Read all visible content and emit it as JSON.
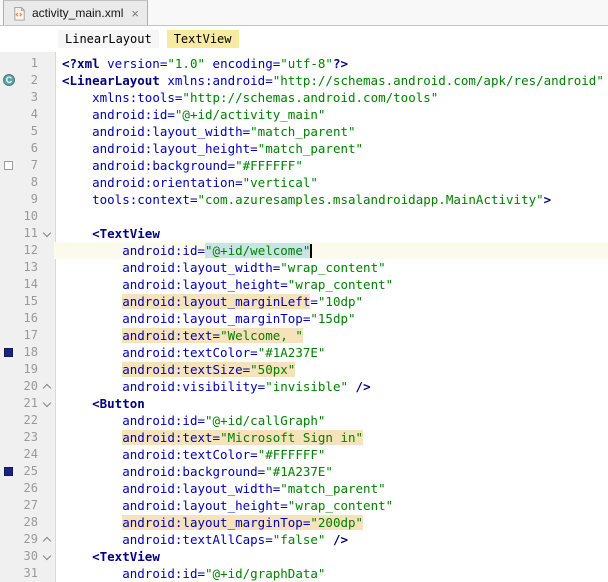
{
  "tab_bar": {
    "tabs": [
      {
        "label": "activity_main.xml",
        "close_glyph": "×"
      }
    ]
  },
  "breadcrumbs": {
    "items": [
      {
        "label": "LinearLayout",
        "current": false
      },
      {
        "label": "TextView",
        "current": true
      }
    ]
  },
  "icons": {
    "class_marker": "C"
  },
  "colors": {
    "tag": "#000080",
    "attribute": "#0000B3",
    "value": "#008000",
    "caret_row": "#FCFAED",
    "usage_highlight": "#F6E3BC",
    "identifier_highlight": "#C8E4E4",
    "swatch_white": "#FFFFFF",
    "swatch_navy": "#1A237E",
    "gutter_bg": "#F0F0F0",
    "breadcrumb_highlight": "#F7EBA1"
  },
  "editor": {
    "lines": [
      {
        "num": 1,
        "tokens": [
          {
            "t": "<?xml ",
            "c": "tag"
          },
          {
            "t": "version=",
            "c": "attr"
          },
          {
            "t": "\"1.0\"",
            "c": "val"
          },
          {
            "t": " ",
            "c": "plain"
          },
          {
            "t": "encoding=",
            "c": "attr"
          },
          {
            "t": "\"utf-8\"",
            "c": "val"
          },
          {
            "t": "?>",
            "c": "tag"
          }
        ]
      },
      {
        "num": 2,
        "gutter_icon": "class-c",
        "tokens": [
          {
            "t": "<LinearLayout ",
            "c": "tag"
          },
          {
            "t": "xmlns:android=",
            "c": "attr"
          },
          {
            "t": "\"http://schemas.android.com/apk/res/android\"",
            "c": "val"
          }
        ]
      },
      {
        "num": 3,
        "tokens": [
          {
            "t": "    ",
            "c": "plain"
          },
          {
            "t": "xmlns:tools=",
            "c": "attr"
          },
          {
            "t": "\"http://schemas.android.com/tools\"",
            "c": "val"
          }
        ]
      },
      {
        "num": 4,
        "tokens": [
          {
            "t": "    ",
            "c": "plain"
          },
          {
            "t": "android:id=",
            "c": "attr"
          },
          {
            "t": "\"@+id/activity_main\"",
            "c": "val"
          }
        ]
      },
      {
        "num": 5,
        "tokens": [
          {
            "t": "    ",
            "c": "plain"
          },
          {
            "t": "android:layout_width=",
            "c": "attr"
          },
          {
            "t": "\"match_parent\"",
            "c": "val"
          }
        ]
      },
      {
        "num": 6,
        "tokens": [
          {
            "t": "    ",
            "c": "plain"
          },
          {
            "t": "android:layout_height=",
            "c": "attr"
          },
          {
            "t": "\"match_parent\"",
            "c": "val"
          }
        ]
      },
      {
        "num": 7,
        "gutter_icon": "swatch-white",
        "tokens": [
          {
            "t": "    ",
            "c": "plain"
          },
          {
            "t": "android:background=",
            "c": "attr"
          },
          {
            "t": "\"#FFFFFF\"",
            "c": "val"
          }
        ]
      },
      {
        "num": 8,
        "tokens": [
          {
            "t": "    ",
            "c": "plain"
          },
          {
            "t": "android:orientation=",
            "c": "attr"
          },
          {
            "t": "\"vertical\"",
            "c": "val"
          }
        ]
      },
      {
        "num": 9,
        "tokens": [
          {
            "t": "    ",
            "c": "plain"
          },
          {
            "t": "tools:context=",
            "c": "attr"
          },
          {
            "t": "\"com.azuresamples.msalandroidapp.MainActivity\"",
            "c": "val"
          },
          {
            "t": ">",
            "c": "tag"
          }
        ]
      },
      {
        "num": 10,
        "tokens": []
      },
      {
        "num": 11,
        "fold": "down",
        "tokens": [
          {
            "t": "    ",
            "c": "plain"
          },
          {
            "t": "<TextView",
            "c": "tag"
          }
        ]
      },
      {
        "num": 12,
        "caret_row": true,
        "tokens": [
          {
            "t": "        ",
            "c": "plain"
          },
          {
            "t": "android:id=",
            "c": "attr"
          },
          {
            "t": "\"@+id/welcome\"",
            "c": "val",
            "h": "id",
            "caret_after": true
          }
        ]
      },
      {
        "num": 13,
        "tokens": [
          {
            "t": "        ",
            "c": "plain"
          },
          {
            "t": "android:layout_width=",
            "c": "attr"
          },
          {
            "t": "\"wrap_content\"",
            "c": "val"
          }
        ]
      },
      {
        "num": 14,
        "tokens": [
          {
            "t": "        ",
            "c": "plain"
          },
          {
            "t": "android:layout_height=",
            "c": "attr"
          },
          {
            "t": "\"wrap_content\"",
            "c": "val"
          }
        ]
      },
      {
        "num": 15,
        "tokens": [
          {
            "t": "        ",
            "c": "plain"
          },
          {
            "t": "android:layout_marginLeft",
            "c": "attr",
            "h": "tan"
          },
          {
            "t": "=",
            "c": "attr"
          },
          {
            "t": "\"10dp\"",
            "c": "val"
          }
        ]
      },
      {
        "num": 16,
        "tokens": [
          {
            "t": "        ",
            "c": "plain"
          },
          {
            "t": "android:layout_marginTop=",
            "c": "attr"
          },
          {
            "t": "\"15dp\"",
            "c": "val"
          }
        ]
      },
      {
        "num": 17,
        "tokens": [
          {
            "t": "        ",
            "c": "plain"
          },
          {
            "t": "android:text=",
            "c": "attr",
            "h": "tan"
          },
          {
            "t": "\"Welcome, \"",
            "c": "val",
            "h": "tan"
          }
        ]
      },
      {
        "num": 18,
        "gutter_icon": "swatch-navy",
        "tokens": [
          {
            "t": "        ",
            "c": "plain"
          },
          {
            "t": "android:textColor=",
            "c": "attr"
          },
          {
            "t": "\"#1A237E\"",
            "c": "val"
          }
        ]
      },
      {
        "num": 19,
        "tokens": [
          {
            "t": "        ",
            "c": "plain"
          },
          {
            "t": "android:textSize=",
            "c": "attr",
            "h": "tan"
          },
          {
            "t": "\"50px\"",
            "c": "val",
            "h": "tan"
          }
        ]
      },
      {
        "num": 20,
        "fold": "up",
        "tokens": [
          {
            "t": "        ",
            "c": "plain"
          },
          {
            "t": "android:visibility=",
            "c": "attr"
          },
          {
            "t": "\"invisible\"",
            "c": "val"
          },
          {
            "t": " />",
            "c": "tag"
          }
        ]
      },
      {
        "num": 21,
        "fold": "down",
        "tokens": [
          {
            "t": "    ",
            "c": "plain"
          },
          {
            "t": "<Button",
            "c": "tag"
          }
        ]
      },
      {
        "num": 22,
        "tokens": [
          {
            "t": "        ",
            "c": "plain"
          },
          {
            "t": "android:id=",
            "c": "attr"
          },
          {
            "t": "\"@+id/callGraph\"",
            "c": "val"
          }
        ]
      },
      {
        "num": 23,
        "tokens": [
          {
            "t": "        ",
            "c": "plain"
          },
          {
            "t": "android:text=",
            "c": "attr",
            "h": "tan"
          },
          {
            "t": "\"Microsoft Sign in\"",
            "c": "val",
            "h": "tan"
          }
        ]
      },
      {
        "num": 24,
        "tokens": [
          {
            "t": "        ",
            "c": "plain"
          },
          {
            "t": "android:textColor=",
            "c": "attr"
          },
          {
            "t": "\"#FFFFFF\"",
            "c": "val"
          }
        ]
      },
      {
        "num": 25,
        "gutter_icon": "swatch-navy",
        "tokens": [
          {
            "t": "        ",
            "c": "plain"
          },
          {
            "t": "android:background=",
            "c": "attr"
          },
          {
            "t": "\"#1A237E\"",
            "c": "val"
          }
        ]
      },
      {
        "num": 26,
        "tokens": [
          {
            "t": "        ",
            "c": "plain"
          },
          {
            "t": "android:layout_width=",
            "c": "attr"
          },
          {
            "t": "\"match_parent\"",
            "c": "val"
          }
        ]
      },
      {
        "num": 27,
        "tokens": [
          {
            "t": "        ",
            "c": "plain"
          },
          {
            "t": "android:layout_height=",
            "c": "attr"
          },
          {
            "t": "\"wrap_content\"",
            "c": "val"
          }
        ]
      },
      {
        "num": 28,
        "tokens": [
          {
            "t": "        ",
            "c": "plain"
          },
          {
            "t": "android:layout_marginTop=",
            "c": "attr",
            "h": "tan"
          },
          {
            "t": "\"200dp\"",
            "c": "val",
            "h": "tan"
          }
        ]
      },
      {
        "num": 29,
        "fold": "up",
        "tokens": [
          {
            "t": "        ",
            "c": "plain"
          },
          {
            "t": "android:textAllCaps=",
            "c": "attr"
          },
          {
            "t": "\"false\"",
            "c": "val"
          },
          {
            "t": " />",
            "c": "tag"
          }
        ]
      },
      {
        "num": 30,
        "fold": "down",
        "tokens": [
          {
            "t": "    ",
            "c": "plain"
          },
          {
            "t": "<TextView",
            "c": "tag"
          }
        ]
      },
      {
        "num": 31,
        "tokens": [
          {
            "t": "        ",
            "c": "plain"
          },
          {
            "t": "android:id=",
            "c": "attr"
          },
          {
            "t": "\"@+id/graphData\"",
            "c": "val"
          }
        ]
      }
    ]
  }
}
